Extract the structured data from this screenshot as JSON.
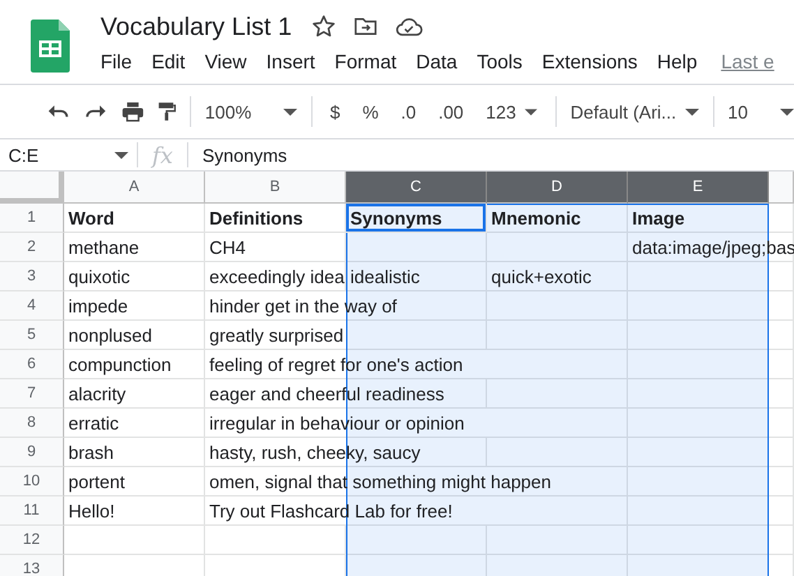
{
  "app": {
    "title": "Vocabulary List 1"
  },
  "menu": [
    "File",
    "Edit",
    "View",
    "Insert",
    "Format",
    "Data",
    "Tools",
    "Extensions",
    "Help"
  ],
  "last_edit": "Last e",
  "toolbar": {
    "zoom": "100%",
    "currency": "$",
    "percent": "%",
    "decimal_decrease": ".0",
    "decimal_increase": ".00",
    "more_formats": "123",
    "font": "Default (Ari...",
    "font_size": "10"
  },
  "formula_bar": {
    "name_box": "C:E",
    "fx": "fx",
    "content": "Synonyms"
  },
  "sheet": {
    "columns": [
      {
        "label": "A",
        "selected": false
      },
      {
        "label": "B",
        "selected": false
      },
      {
        "label": "C",
        "selected": true
      },
      {
        "label": "D",
        "selected": true
      },
      {
        "label": "E",
        "selected": true
      }
    ],
    "header_row": {
      "number": "1",
      "cells": [
        {
          "text": "Word",
          "active": false
        },
        {
          "text": "Definitions",
          "active": false
        },
        {
          "text": "Synonyms",
          "active": true
        },
        {
          "text": "Mnemonic",
          "active": false
        },
        {
          "text": "Image",
          "active": false
        }
      ]
    },
    "rows": [
      {
        "number": "2",
        "cells": [
          {
            "text": "methane",
            "active": false
          },
          {
            "text": "CH4",
            "active": false
          },
          {
            "active": false
          },
          {
            "active": false
          },
          {
            "text": "data:image/jpeg;bas",
            "active": false
          }
        ]
      },
      {
        "number": "3",
        "cells": [
          {
            "text": "quixotic",
            "active": false
          },
          {
            "text": "exceedingly idea",
            "active": false
          },
          {
            "text": "idealistic",
            "active": false
          },
          {
            "text": "quick+exotic",
            "active": false
          },
          {
            "active": false
          }
        ]
      },
      {
        "number": "4",
        "cells": [
          {
            "text": "impede",
            "active": false
          },
          {
            "text": "hinder get in the way of",
            "active": false
          },
          {
            "active": false
          },
          {
            "active": false
          },
          {
            "active": false
          }
        ]
      },
      {
        "number": "5",
        "cells": [
          {
            "text": "nonplused",
            "active": false
          },
          {
            "text": "greatly surprised",
            "active": false
          },
          {
            "active": false
          },
          {
            "active": false
          },
          {
            "active": false
          }
        ]
      },
      {
        "number": "6",
        "cells": [
          {
            "text": "compunction",
            "active": false
          },
          {
            "text": "feeling of regret for one's action",
            "active": false
          },
          {
            "active": false
          },
          {
            "active": false
          },
          {
            "active": false
          }
        ]
      },
      {
        "number": "7",
        "cells": [
          {
            "text": "alacrity",
            "active": false
          },
          {
            "text": "eager and cheerful readiness",
            "active": false
          },
          {
            "active": false
          },
          {
            "active": false
          },
          {
            "active": false
          }
        ]
      },
      {
        "number": "8",
        "cells": [
          {
            "text": "erratic",
            "active": false
          },
          {
            "text": "irregular in behaviour or opinion",
            "active": false
          },
          {
            "active": false
          },
          {
            "active": false
          },
          {
            "active": false
          }
        ]
      },
      {
        "number": "9",
        "cells": [
          {
            "text": "brash",
            "active": false
          },
          {
            "text": "hasty, rush, cheeky, saucy",
            "active": false
          },
          {
            "active": false
          },
          {
            "active": false
          },
          {
            "active": false
          }
        ]
      },
      {
        "number": "10",
        "cells": [
          {
            "text": "portent",
            "active": false
          },
          {
            "text": "omen, signal that something might happen",
            "active": false
          },
          {
            "active": false
          },
          {
            "active": false
          },
          {
            "active": false
          }
        ]
      },
      {
        "number": "11",
        "cells": [
          {
            "text": "Hello!",
            "active": false
          },
          {
            "text": "Try out Flashcard Lab for free!",
            "active": false
          },
          {
            "active": false
          },
          {
            "active": false
          },
          {
            "active": false
          }
        ]
      },
      {
        "number": "12",
        "cells": [
          {
            "active": false
          },
          {
            "active": false
          },
          {
            "active": false
          },
          {
            "active": false
          },
          {
            "active": false
          }
        ]
      },
      {
        "number": "13",
        "cells": [
          {
            "active": false
          },
          {
            "active": false
          },
          {
            "active": false
          },
          {
            "active": false
          },
          {
            "active": false
          }
        ]
      }
    ]
  }
}
